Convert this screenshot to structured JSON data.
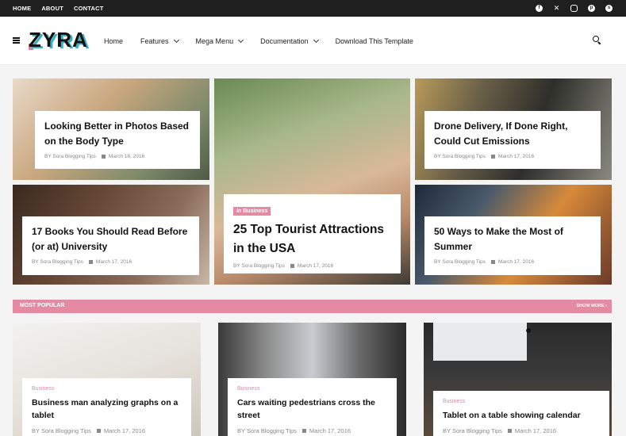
{
  "topbar": {
    "links": [
      "HOME",
      "ABOUT",
      "CONTACT"
    ],
    "social_icons": [
      "facebook-icon",
      "x-icon",
      "instagram-icon",
      "pinterest-icon",
      "skype-icon"
    ]
  },
  "header": {
    "logo": "ZYRA",
    "nav": [
      "Home",
      "Features",
      "Mega Menu",
      "Documentation",
      "Download This Template"
    ]
  },
  "featured": [
    {
      "title": "Looking Better in Photos Based on the Body Type",
      "author": "BY Sora Blogging Tips",
      "date": "March 18, 2016"
    },
    {
      "title": "25 Top Tourist Attractions in the USA",
      "tag_prefix": "In",
      "tag": "Business",
      "author": "BY Sora Blogging Tips",
      "date": "March 17, 2016"
    },
    {
      "title": "Drone Delivery, If Done Right, Could Cut Emissions",
      "author": "BY Sora Blogging Tips",
      "date": "March 17, 2016"
    },
    {
      "title": "17 Books You Should Read Before (or at) University",
      "author": "BY Sora Blogging Tips",
      "date": "March 17, 2016"
    },
    {
      "title": "50 Ways to Make the Most of Summer",
      "author": "BY Sora Blogging Tips",
      "date": "March 17, 2016"
    }
  ],
  "popular": {
    "title": "MOST POPULAR",
    "more": "SHOW MORE ›",
    "items": [
      {
        "category": "Business",
        "title": "Business man analyzing graphs on a tablet",
        "author": "BY Sora Blogging Tips",
        "date": "March 17, 2016"
      },
      {
        "category": "Business",
        "title": "Cars waiting pedestrians cross the street",
        "author": "BY Sora Blogging Tips",
        "date": "March 17, 2016"
      },
      {
        "category": "Business",
        "title": "Tablet on a table showing calendar",
        "author": "BY Sora Blogging Tips",
        "date": "March 17, 2016"
      }
    ]
  }
}
